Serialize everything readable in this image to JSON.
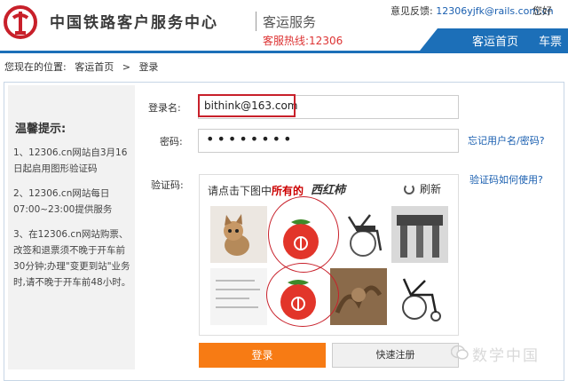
{
  "header": {
    "org_name": "中国铁路客户服务中心",
    "service_name": "客运服务",
    "hotline": "客服热线:12306",
    "feedback_label": "意见反馈:",
    "feedback_email": "12306yjfk@rails.com.cn",
    "greeting": "您好",
    "nav": [
      "客运首页",
      "车票预"
    ],
    "brand_color": "#1c6fb8"
  },
  "breadcrumb": [
    "您现在的位置:",
    "客运首页",
    ">",
    "登录"
  ],
  "tips": {
    "title": "温馨提示:",
    "items": [
      "1、12306.cn网站自3月16日起启用图形验证码",
      "2、12306.cn网站每日07:00~23:00提供服务",
      "3、在12306.cn网站购票、改签和退票须不晚于开车前30分钟;办理\"变更到站\"业务时,请不晚于开车前48小时。"
    ]
  },
  "form": {
    "username_label": "登录名:",
    "username_value": "bithink@163.com",
    "password_label": "密码:",
    "password_value": "••••••••",
    "forgot_link": "忘记用户名/密码?",
    "captcha_label": "验证码:",
    "captcha_help_link": "验证码如何使用?",
    "captcha_prompt_prefix": "请点击下图中",
    "captcha_prompt_emphasis": "所有的",
    "captcha_target": "西红柿",
    "refresh_label": "刷新",
    "tiles": [
      "kitten-photo",
      "tomato-with-logo",
      "wheelchair",
      "stone-archway",
      "handwriting-paper",
      "tomato-with-logo",
      "carved-wood",
      "wheelchair"
    ],
    "accent_red": "#c8202a"
  },
  "buttons": {
    "login": "登录",
    "register": "快速注册",
    "login_color": "#f77b14"
  },
  "watermark": "数学中国"
}
